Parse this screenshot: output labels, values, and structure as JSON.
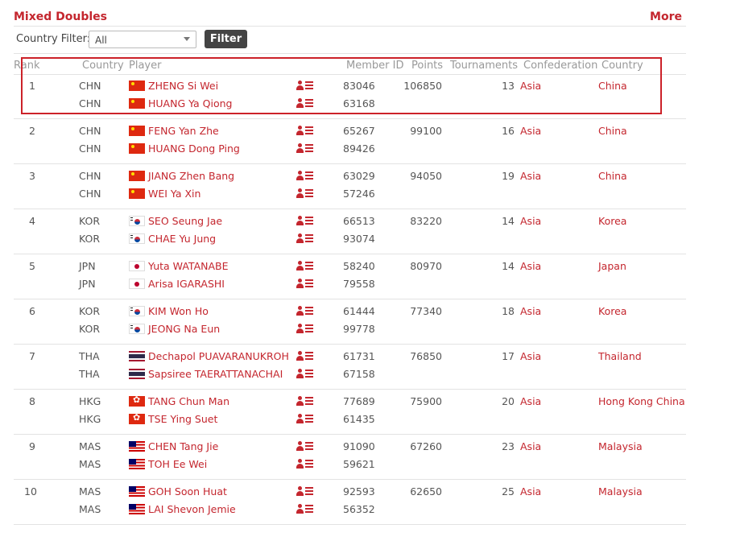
{
  "header": {
    "title": "Mixed Doubles",
    "more_label": "More"
  },
  "filter": {
    "label": "Country Filter:",
    "selected": "All",
    "button_label": "Filter"
  },
  "columns": [
    "Rank",
    "Country",
    "Player",
    "Member ID",
    "Points",
    "Tournaments",
    "Confederation",
    "Country"
  ],
  "rows": [
    {
      "rank": "1",
      "points": "106850",
      "tournaments": "13",
      "confederation": "Asia",
      "country_name": "China",
      "players": [
        {
          "code": "CHN",
          "flag": "chn",
          "name": "ZHENG Si Wei",
          "member_id": "83046"
        },
        {
          "code": "CHN",
          "flag": "chn",
          "name": "HUANG Ya Qiong",
          "member_id": "63168"
        }
      ]
    },
    {
      "rank": "2",
      "points": "99100",
      "tournaments": "16",
      "confederation": "Asia",
      "country_name": "China",
      "players": [
        {
          "code": "CHN",
          "flag": "chn",
          "name": "FENG Yan Zhe",
          "member_id": "65267"
        },
        {
          "code": "CHN",
          "flag": "chn",
          "name": "HUANG Dong Ping",
          "member_id": "89426"
        }
      ]
    },
    {
      "rank": "3",
      "points": "94050",
      "tournaments": "19",
      "confederation": "Asia",
      "country_name": "China",
      "players": [
        {
          "code": "CHN",
          "flag": "chn",
          "name": "JIANG Zhen Bang",
          "member_id": "63029"
        },
        {
          "code": "CHN",
          "flag": "chn",
          "name": "WEI Ya Xin",
          "member_id": "57246"
        }
      ]
    },
    {
      "rank": "4",
      "points": "83220",
      "tournaments": "14",
      "confederation": "Asia",
      "country_name": "Korea",
      "players": [
        {
          "code": "KOR",
          "flag": "kor",
          "name": "SEO Seung Jae",
          "member_id": "66513"
        },
        {
          "code": "KOR",
          "flag": "kor",
          "name": "CHAE Yu Jung",
          "member_id": "93074"
        }
      ]
    },
    {
      "rank": "5",
      "points": "80970",
      "tournaments": "14",
      "confederation": "Asia",
      "country_name": "Japan",
      "players": [
        {
          "code": "JPN",
          "flag": "jpn",
          "name": "Yuta WATANABE",
          "member_id": "58240"
        },
        {
          "code": "JPN",
          "flag": "jpn",
          "name": "Arisa IGARASHI",
          "member_id": "79558"
        }
      ]
    },
    {
      "rank": "6",
      "points": "77340",
      "tournaments": "18",
      "confederation": "Asia",
      "country_name": "Korea",
      "players": [
        {
          "code": "KOR",
          "flag": "kor",
          "name": "KIM Won Ho",
          "member_id": "61444"
        },
        {
          "code": "KOR",
          "flag": "kor",
          "name": "JEONG Na Eun",
          "member_id": "99778"
        }
      ]
    },
    {
      "rank": "7",
      "points": "76850",
      "tournaments": "17",
      "confederation": "Asia",
      "country_name": "Thailand",
      "players": [
        {
          "code": "THA",
          "flag": "tha",
          "name": "Dechapol PUAVARANUKROH",
          "member_id": "61731"
        },
        {
          "code": "THA",
          "flag": "tha",
          "name": "Sapsiree TAERATTANACHAI",
          "member_id": "67158"
        }
      ]
    },
    {
      "rank": "8",
      "points": "75900",
      "tournaments": "20",
      "confederation": "Asia",
      "country_name": "Hong Kong China",
      "players": [
        {
          "code": "HKG",
          "flag": "hkg",
          "name": "TANG Chun Man",
          "member_id": "77689"
        },
        {
          "code": "HKG",
          "flag": "hkg",
          "name": "TSE Ying Suet",
          "member_id": "61435"
        }
      ]
    },
    {
      "rank": "9",
      "points": "67260",
      "tournaments": "23",
      "confederation": "Asia",
      "country_name": "Malaysia",
      "players": [
        {
          "code": "MAS",
          "flag": "mas",
          "name": "CHEN Tang Jie",
          "member_id": "91090"
        },
        {
          "code": "MAS",
          "flag": "mas",
          "name": "TOH Ee Wei",
          "member_id": "59621"
        }
      ]
    },
    {
      "rank": "10",
      "points": "62650",
      "tournaments": "25",
      "confederation": "Asia",
      "country_name": "Malaysia",
      "players": [
        {
          "code": "MAS",
          "flag": "mas",
          "name": "GOH Soon Huat",
          "member_id": "92593"
        },
        {
          "code": "MAS",
          "flag": "mas",
          "name": "LAI Shevon Jemie",
          "member_id": "56352"
        }
      ]
    }
  ],
  "colors": {
    "accent": "#c4262e",
    "highlight": "#cc2229",
    "button": "#444444"
  }
}
